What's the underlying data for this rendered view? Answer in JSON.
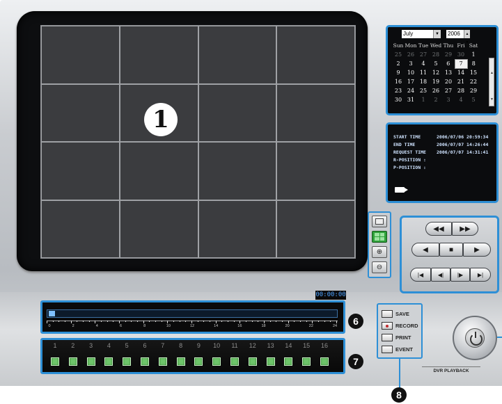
{
  "video": {
    "marker": "1",
    "grid_rows": 4,
    "grid_cols": 4
  },
  "calendar": {
    "month": "July",
    "year": "2006",
    "weekdays": [
      "Sun",
      "Mon",
      "Tue",
      "Wed",
      "Thu",
      "Fri",
      "Sat"
    ],
    "weeks": [
      [
        "25",
        "26",
        "27",
        "28",
        "29",
        "30",
        "1"
      ],
      [
        "2",
        "3",
        "4",
        "5",
        "6",
        "7",
        "8"
      ],
      [
        "9",
        "10",
        "11",
        "12",
        "13",
        "14",
        "15"
      ],
      [
        "16",
        "17",
        "18",
        "19",
        "20",
        "21",
        "22"
      ],
      [
        "23",
        "24",
        "25",
        "26",
        "27",
        "28",
        "29"
      ],
      [
        "30",
        "31",
        "1",
        "2",
        "3",
        "4",
        "5"
      ]
    ],
    "selected_day": "7"
  },
  "info": {
    "rows": [
      {
        "key": "START TIME",
        "value": "2006/07/06 20:59:34"
      },
      {
        "key": "END TIME",
        "value": "2006/07/07 14:26:44"
      },
      {
        "key": "REQUEST TIME",
        "value": "2006/07/07 14:31:41"
      },
      {
        "key": "R-POSITION :",
        "value": ""
      },
      {
        "key": "P-POSITION :",
        "value": ""
      }
    ]
  },
  "view_controls": {
    "single_icon": "single-view-icon",
    "quad_icon": "quad-view-icon",
    "zoom_in": "⊕",
    "zoom_out": "⊖"
  },
  "playback": {
    "rewind": "◀◀",
    "fast_forward": "▶▶",
    "play_back": "◀",
    "stop": "■",
    "play": "▶",
    "first": "|◀",
    "step_back": "◀|",
    "step_forward": "|▶",
    "last": "▶|"
  },
  "timeline": {
    "time": "00:00:00",
    "labels": [
      "0",
      "2",
      "4",
      "6",
      "8",
      "10",
      "12",
      "14",
      "16",
      "18",
      "20",
      "22",
      "24"
    ],
    "callout": "6"
  },
  "channels": {
    "numbers": [
      "1",
      "2",
      "3",
      "4",
      "5",
      "6",
      "7",
      "8",
      "9",
      "10",
      "11",
      "12",
      "13",
      "14",
      "15",
      "16"
    ],
    "callout": "7"
  },
  "options": {
    "items": [
      {
        "label": "SAVE",
        "checked": false
      },
      {
        "label": "RECORD",
        "checked": true
      },
      {
        "label": "PRINT",
        "checked": false
      },
      {
        "label": "EVENT",
        "checked": false
      }
    ],
    "callout": "8"
  },
  "dvr_label": "DVR PLAYBACK",
  "colors": {
    "highlight": "#2d8fd6",
    "channel_button": "#6ec56a",
    "sunday": "#e03a3a",
    "saturday": "#6a7ef0"
  }
}
